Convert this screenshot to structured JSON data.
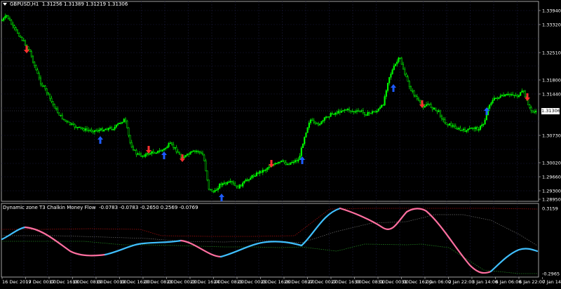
{
  "chart_header": {
    "symbol": "GBPUSD,H1",
    "open": "1.31256",
    "high": "1.31389",
    "low": "1.31219",
    "close": "1.31306"
  },
  "indicator_header": {
    "name": "Dynamic zone T3 Chalkin Money Flow",
    "values": "-0.0783 -0.0783 -0.2650 0.2569 -0.0769"
  },
  "current_price": "1.31306",
  "main_axis_labels": [
    "1.33940",
    "1.33320",
    "1.32510",
    "1.31800",
    "1.31440",
    "1.30730",
    "1.30020",
    "1.29660",
    "1.29300",
    "1.28950"
  ],
  "indicator_axis_labels": [
    "0.3159",
    "-0.2965"
  ],
  "time_axis_labels": [
    "16 Dec 2019",
    "17 Dec 00:00",
    "17 Dec 16:00",
    "18 Dec 08:00",
    "19 Dec 00:00",
    "19 Dec 16:00",
    "20 Dec 08:00",
    "23 Dec 00:00",
    "23 Dec 16:00",
    "24 Dec 08:00",
    "25 Dec 00:00",
    "25 Dec 16:00",
    "26 Dec 08:00",
    "27 Dec 00:00",
    "27 Dec 16:00",
    "30 Dec 08:00",
    "31 Dec 00:00",
    "31 Dec 16:00",
    "2 Jan 06:00",
    "2 Jan 22:00",
    "3 Jan 14:00",
    "6 Jan 06:00",
    "6 Jan 22:00",
    "7 Jan 14:00"
  ],
  "colors": {
    "candle": "#00ff00",
    "grid": "#1a1a3a",
    "buy_arrow": "#1e5bff",
    "sell_arrow": "#ff3030",
    "indicator_up": "#40c0ff",
    "indicator_down": "#ff6fa0",
    "upper_zone": "#a01010",
    "lower_zone": "#208020"
  }
}
